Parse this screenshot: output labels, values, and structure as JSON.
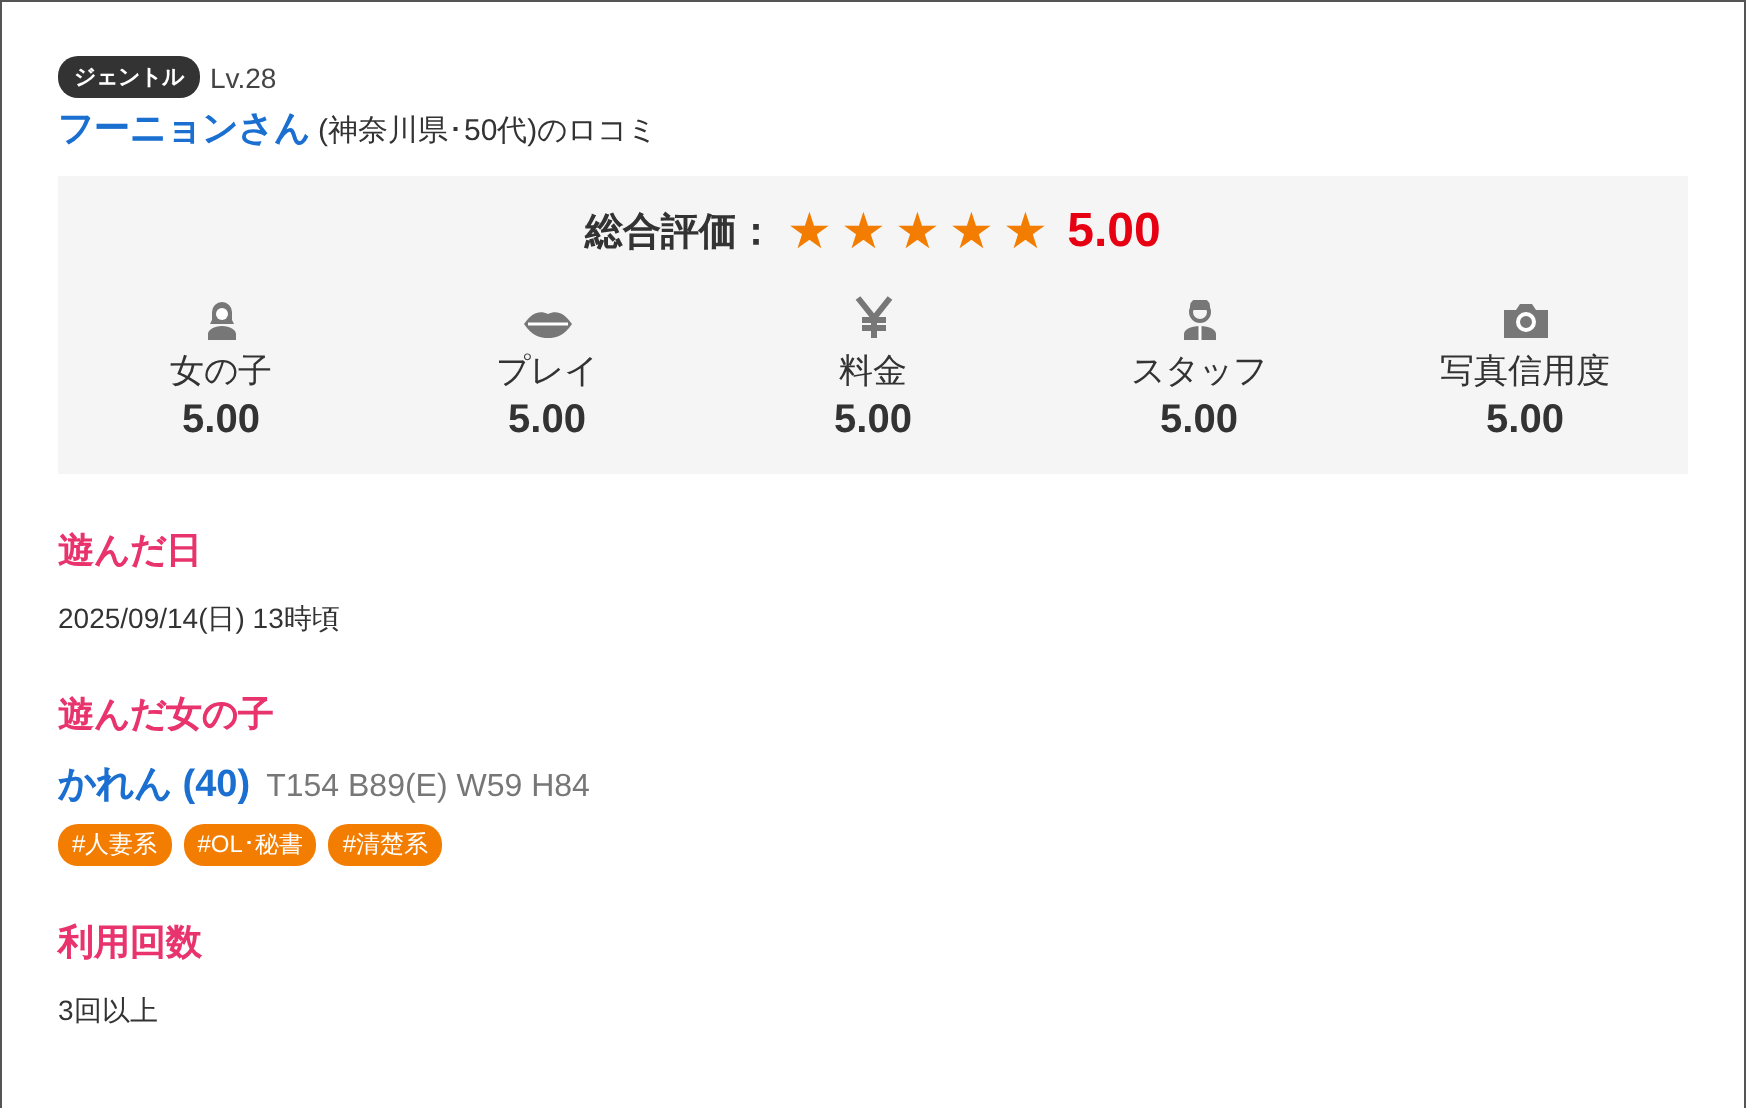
{
  "reviewer": {
    "badge": "ジェントル",
    "level": "Lv.28",
    "name": "フーニョンさん",
    "detail": "(神奈川県･50代)のロコミ"
  },
  "rating": {
    "label": "総合評価：",
    "stars": 5,
    "score": "5.00",
    "categories": [
      {
        "kind": "girl",
        "label": "女の子",
        "score": "5.00"
      },
      {
        "kind": "lips",
        "label": "プレイ",
        "score": "5.00"
      },
      {
        "kind": "yen",
        "label": "料金",
        "score": "5.00"
      },
      {
        "kind": "staff",
        "label": "スタッフ",
        "score": "5.00"
      },
      {
        "kind": "camera",
        "label": "写真信用度",
        "score": "5.00"
      }
    ]
  },
  "sections": [
    {
      "kind": "text",
      "heading": "遊んだ日",
      "text": "2025/09/14(日) 13時頃"
    },
    {
      "kind": "girl",
      "heading": "遊んだ女の子",
      "name": "かれん (40)",
      "size": "T154 B89(E) W59 H84",
      "tags": [
        "#人妻系",
        "#OL･秘書",
        "#清楚系"
      ]
    },
    {
      "kind": "text",
      "heading": "利用回数",
      "text": "3回以上"
    }
  ]
}
